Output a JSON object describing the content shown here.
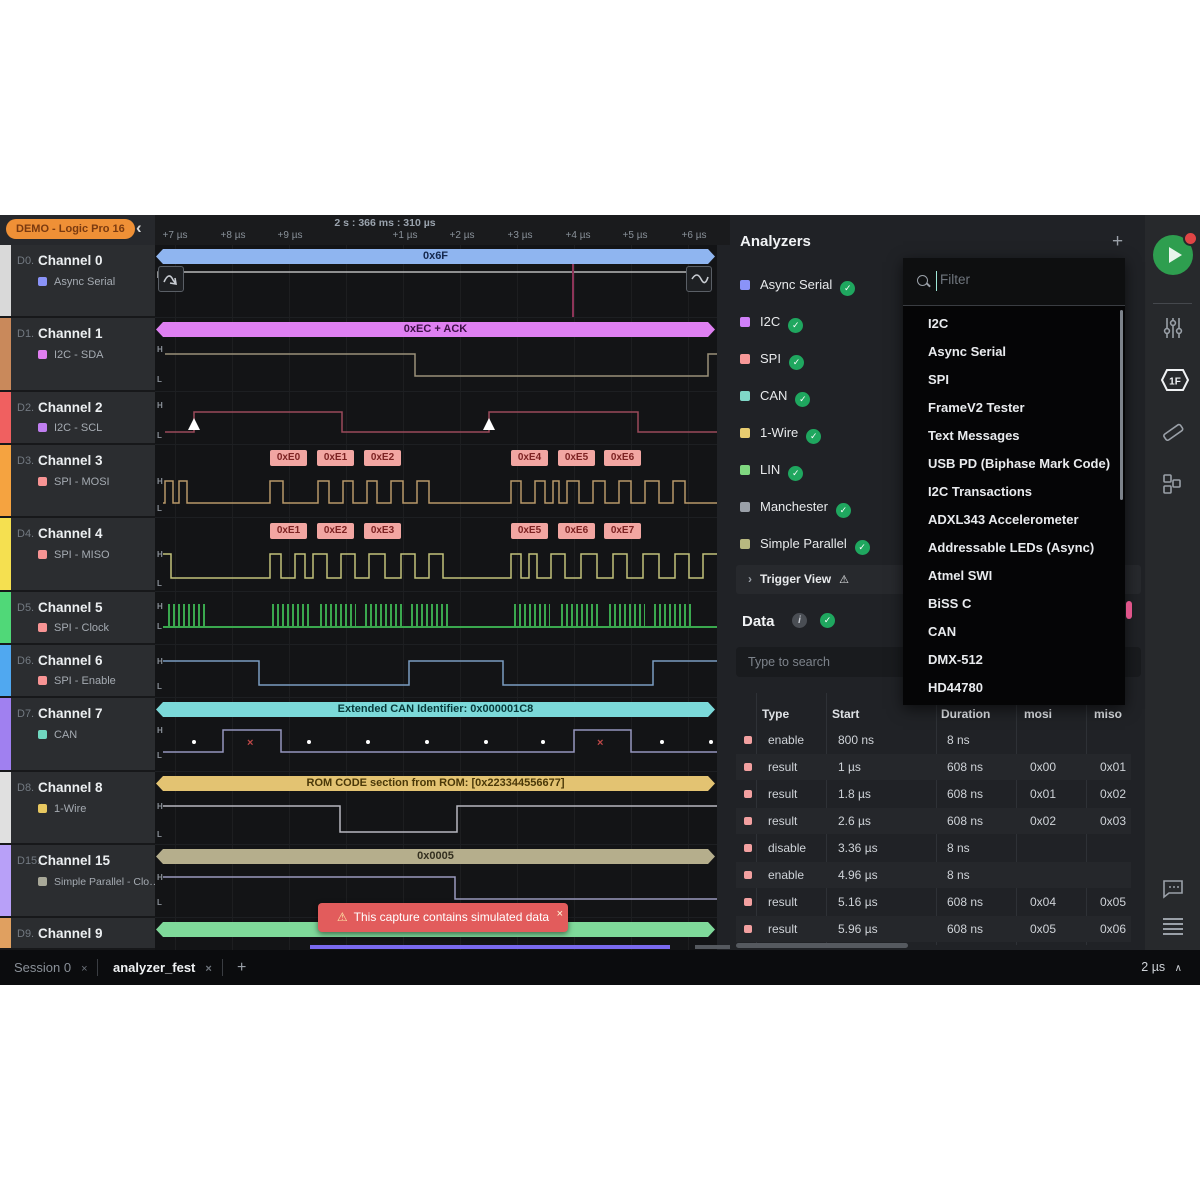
{
  "app": {
    "badge": "DEMO - Logic Pro 16",
    "timeline_title": "2 s : 366 ms : 310 µs",
    "ticks": [
      "+7 µs",
      "+8 µs",
      "+9 µs",
      "+1 µs",
      "+2 µs",
      "+3 µs",
      "+4 µs",
      "+5 µs",
      "+6 µs"
    ]
  },
  "icons": {
    "close": "×",
    "error": "×",
    "check": "✓",
    "warning": "⚠",
    "chevron_left": "‹",
    "chevron_right": "›",
    "chevron_up": "∧",
    "plus": "+",
    "info": "i",
    "hex_label": "1F"
  },
  "wave_markers": {
    "high": "H",
    "low": "L"
  },
  "channels": [
    {
      "id": "D0.",
      "name": "Channel 0",
      "analyzer": "Async Serial"
    },
    {
      "id": "D1.",
      "name": "Channel 1",
      "analyzer": "I2C - SDA"
    },
    {
      "id": "D2.",
      "name": "Channel 2",
      "analyzer": "I2C - SCL"
    },
    {
      "id": "D3.",
      "name": "Channel 3",
      "analyzer": "SPI - MOSI"
    },
    {
      "id": "D4.",
      "name": "Channel 4",
      "analyzer": "SPI - MISO"
    },
    {
      "id": "D5.",
      "name": "Channel 5",
      "analyzer": "SPI - Clock"
    },
    {
      "id": "D6.",
      "name": "Channel 6",
      "analyzer": "SPI - Enable"
    },
    {
      "id": "D7.",
      "name": "Channel 7",
      "analyzer": "CAN"
    },
    {
      "id": "D8.",
      "name": "Channel 8",
      "analyzer": "1-Wire"
    },
    {
      "id": "D15.",
      "name": "Channel 15",
      "analyzer": "Simple Parallel - Clo…"
    },
    {
      "id": "D9.",
      "name": "Channel 9",
      "analyzer": ""
    }
  ],
  "waves": {
    "d0_bar": "0x6F",
    "d1_bar": "0xEC + ACK",
    "d3_badges": [
      "0xE0",
      "0xE1",
      "0xE2",
      "0xE4",
      "0xE5",
      "0xE6"
    ],
    "d4_badges": [
      "0xE1",
      "0xE2",
      "0xE3",
      "0xE5",
      "0xE6",
      "0xE7"
    ],
    "d7_bar": "Extended CAN Identifier: 0x000001C8",
    "d8_bar": "ROM CODE section from ROM: [0x223344556677]",
    "d15_bar": "0x0005"
  },
  "toast": {
    "text": "This capture contains simulated data"
  },
  "analyzers": {
    "title": "Analyzers",
    "items": [
      {
        "label": "Async Serial"
      },
      {
        "label": "I2C"
      },
      {
        "label": "SPI"
      },
      {
        "label": "CAN"
      },
      {
        "label": "1-Wire"
      },
      {
        "label": "LIN"
      },
      {
        "label": "Manchester"
      },
      {
        "label": "Simple Parallel"
      }
    ],
    "trigger_view": "Trigger View"
  },
  "dropdown": {
    "placeholder": "Filter",
    "items": [
      "I2C",
      "Async Serial",
      "SPI",
      "FrameV2 Tester",
      "Text Messages",
      "USB PD (Biphase Mark Code)",
      "I2C Transactions",
      "ADXL343 Accelerometer",
      "Addressable LEDs (Async)",
      "Atmel SWI",
      "BiSS C",
      "CAN",
      "DMX-512",
      "HD44780"
    ]
  },
  "data_panel": {
    "title": "Data",
    "search_placeholder": "Type to search",
    "columns": [
      "Type",
      "Start",
      "Duration",
      "mosi",
      "miso"
    ],
    "rows": [
      {
        "type": "enable",
        "start": "800 ns",
        "duration": "8 ns",
        "mosi": "",
        "miso": ""
      },
      {
        "type": "result",
        "start": "1 µs",
        "duration": "608 ns",
        "mosi": "0x00",
        "miso": "0x01"
      },
      {
        "type": "result",
        "start": "1.8 µs",
        "duration": "608 ns",
        "mosi": "0x01",
        "miso": "0x02"
      },
      {
        "type": "result",
        "start": "2.6 µs",
        "duration": "608 ns",
        "mosi": "0x02",
        "miso": "0x03"
      },
      {
        "type": "disable",
        "start": "3.36 µs",
        "duration": "8 ns",
        "mosi": "",
        "miso": ""
      },
      {
        "type": "enable",
        "start": "4.96 µs",
        "duration": "8 ns",
        "mosi": "",
        "miso": ""
      },
      {
        "type": "result",
        "start": "5.16 µs",
        "duration": "608 ns",
        "mosi": "0x04",
        "miso": "0x05"
      },
      {
        "type": "result",
        "start": "5.96 µs",
        "duration": "608 ns",
        "mosi": "0x05",
        "miso": "0x06"
      }
    ]
  },
  "bottom_bar": {
    "tabs": [
      {
        "label": "Session 0"
      },
      {
        "label": "analyzer_fest"
      }
    ],
    "zoom_label": "2 µs"
  },
  "colors": {
    "accent_orange": "#ef9036",
    "play_green": "#2e9e4f",
    "check_green": "#1fa75f",
    "toast_red": "#e25c5c",
    "badge_pink": "#f2a6a2",
    "bar_blue": "#8fb5f0",
    "bar_magenta": "#df80f2",
    "bar_cyan": "#7bd9d9",
    "bar_gold": "#e3c372",
    "bar_khaki": "#b5ae8c",
    "bar_green": "#7fd99a",
    "stripes": [
      "#d9d9d9",
      "#c9895b",
      "#f06060",
      "#f5a340",
      "#f5e050",
      "#50d878",
      "#50a8f0",
      "#a080f0",
      "#e0e0e0",
      "#b8a0f8",
      "#e0a060"
    ],
    "analyzer_squares": [
      "#8a93f8",
      "#d080f8",
      "#f89898",
      "#80d8c8",
      "#e8cc70",
      "#80d880",
      "#9aa0a8",
      "#b8b880"
    ]
  }
}
